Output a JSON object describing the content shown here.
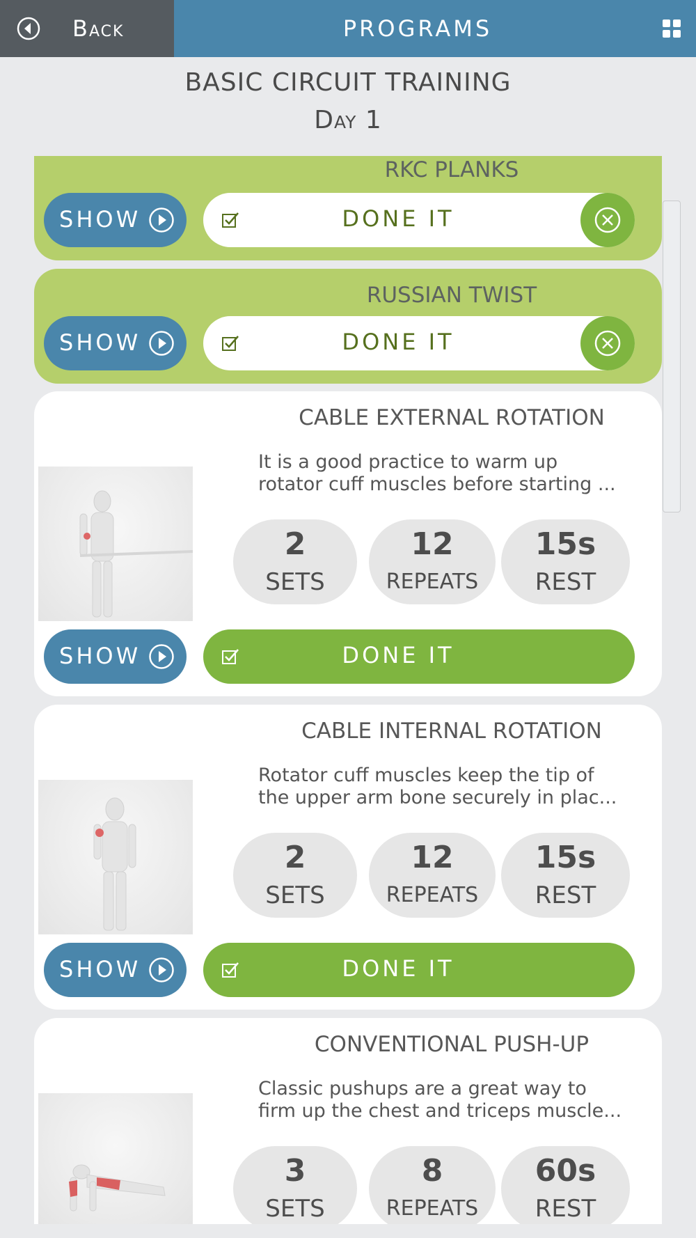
{
  "header": {
    "back_label": "Back",
    "title": "PROGRAMS",
    "accent": "#4a86ab",
    "back_bg": "#555b60"
  },
  "page": {
    "title": "BASIC CIRCUIT TRAINING",
    "subtitle": "Day 1"
  },
  "completed": [
    {
      "name": "RKC PLANKS",
      "show_label": "SHOW",
      "done_label": "DONE IT"
    },
    {
      "name": "RUSSIAN TWIST",
      "show_label": "SHOW",
      "done_label": "DONE IT"
    }
  ],
  "exercises": [
    {
      "name": "CABLE EXTERNAL ROTATION",
      "description_line1": "It is a good practice to warm up",
      "description_line2": "rotator cuff muscles before starting ...",
      "sets": "2",
      "sets_label": "SETS",
      "repeats": "12",
      "repeats_label": "REPEATS",
      "rest": "15s",
      "rest_label": "REST",
      "show_label": "SHOW",
      "done_label": "DONE IT"
    },
    {
      "name": "CABLE INTERNAL ROTATION",
      "description_line1": "Rotator cuff muscles keep the tip of",
      "description_line2": "the upper arm bone securely in plac...",
      "sets": "2",
      "sets_label": "SETS",
      "repeats": "12",
      "repeats_label": "REPEATS",
      "rest": "15s",
      "rest_label": "REST",
      "show_label": "SHOW",
      "done_label": "DONE IT"
    },
    {
      "name": "CONVENTIONAL PUSH-UP",
      "description_line1": "Classic pushups are a great way to",
      "description_line2": "firm up the chest and triceps muscle...",
      "sets": "3",
      "sets_label": "SETS",
      "repeats": "8",
      "repeats_label": "REPEATS",
      "rest": "60s",
      "rest_label": "REST"
    }
  ],
  "colors": {
    "done_card": "#b5cf6b",
    "done_green": "#7fb540",
    "show_blue": "#4a86ab"
  }
}
